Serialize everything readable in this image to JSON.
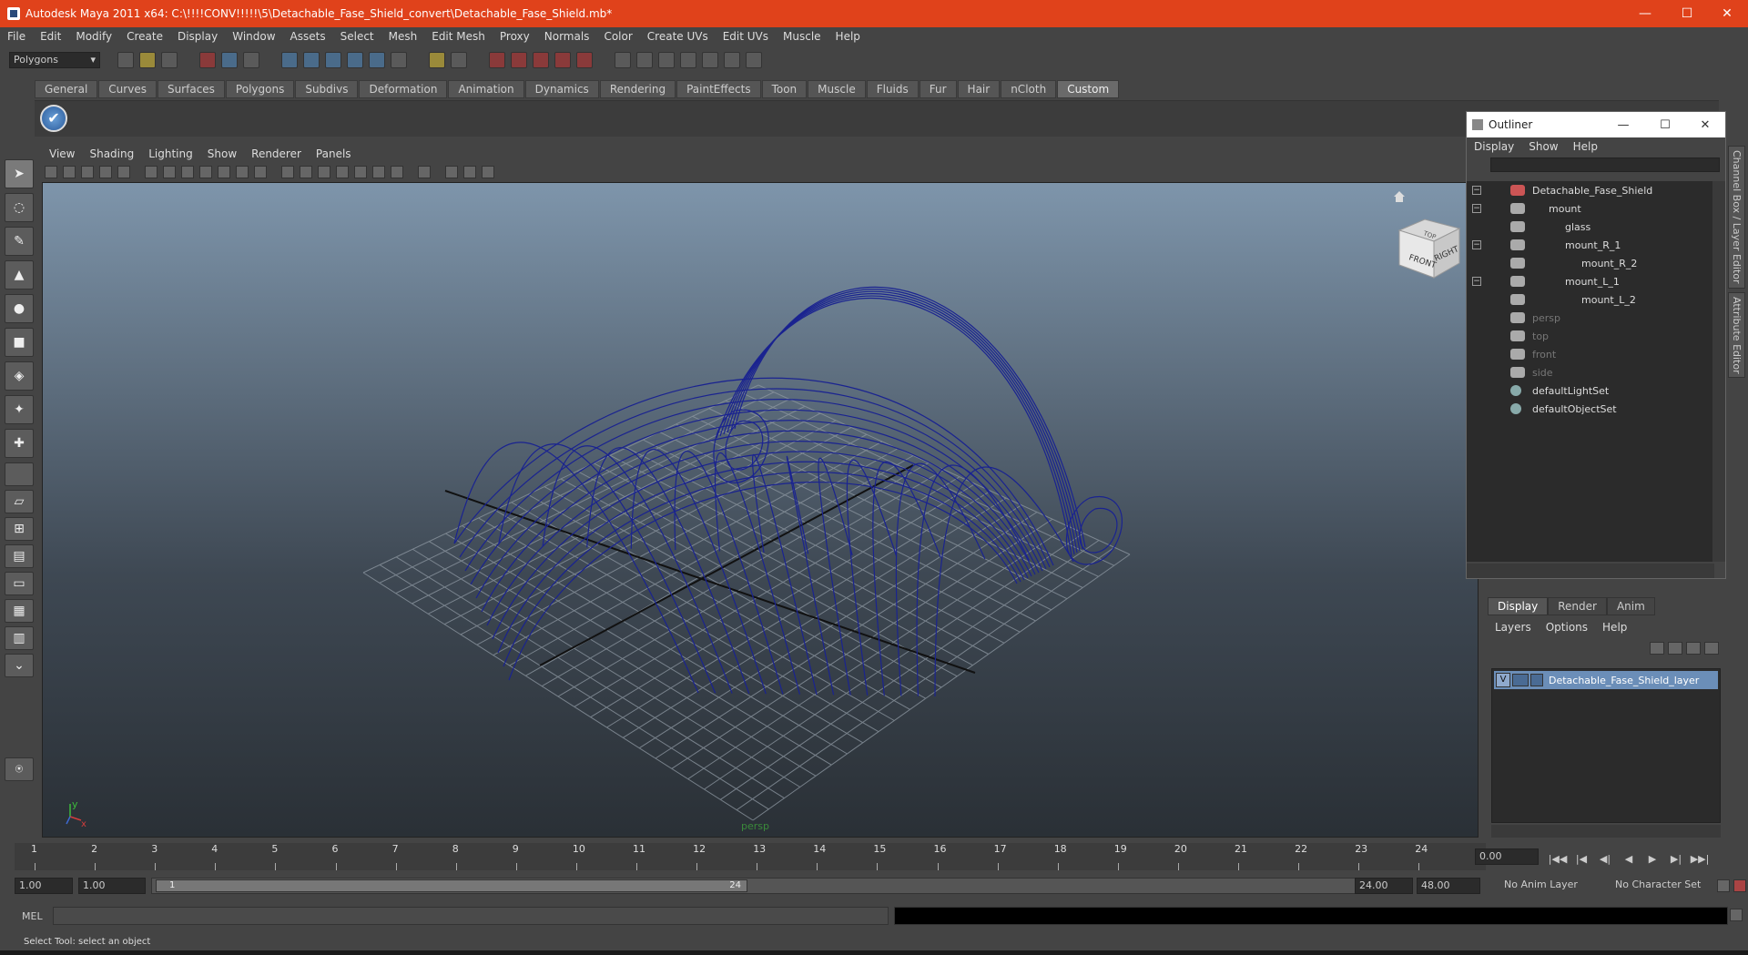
{
  "window": {
    "title": "Autodesk Maya 2011 x64: C:\\!!!!CONV!!!!!\\5\\Detachable_Fase_Shield_convert\\Detachable_Fase_Shield.mb*",
    "minimize": "—",
    "maximize": "☐",
    "close": "✕"
  },
  "menubar": [
    "File",
    "Edit",
    "Modify",
    "Create",
    "Display",
    "Window",
    "Assets",
    "Select",
    "Mesh",
    "Edit Mesh",
    "Proxy",
    "Normals",
    "Color",
    "Create UVs",
    "Edit UVs",
    "Muscle",
    "Help"
  ],
  "status_line": {
    "mode": "Polygons"
  },
  "shelf": {
    "tabs": [
      "General",
      "Curves",
      "Surfaces",
      "Polygons",
      "Subdivs",
      "Deformation",
      "Animation",
      "Dynamics",
      "Rendering",
      "PaintEffects",
      "Toon",
      "Muscle",
      "Fluids",
      "Fur",
      "Hair",
      "nCloth",
      "Custom"
    ],
    "active_tab": "Custom"
  },
  "viewport": {
    "menu": [
      "View",
      "Shading",
      "Lighting",
      "Show",
      "Renderer",
      "Panels"
    ],
    "camera_label": "persp",
    "viewcube": {
      "front": "FRONT",
      "right": "RIGHT",
      "top": "TOP"
    },
    "axis_y": "y",
    "axis_x": "x"
  },
  "outliner": {
    "title": "Outliner",
    "menu": [
      "Display",
      "Show",
      "Help"
    ],
    "items": [
      {
        "label": "Detachable_Fase_Shield",
        "depth": 0,
        "kind": "transform",
        "dim": false
      },
      {
        "label": "mount",
        "depth": 1,
        "kind": "transform",
        "dim": false
      },
      {
        "label": "glass",
        "depth": 2,
        "kind": "transform",
        "dim": false
      },
      {
        "label": "mount_R_1",
        "depth": 2,
        "kind": "transform",
        "dim": false
      },
      {
        "label": "mount_R_2",
        "depth": 3,
        "kind": "transform",
        "dim": false
      },
      {
        "label": "mount_L_1",
        "depth": 2,
        "kind": "transform",
        "dim": false
      },
      {
        "label": "mount_L_2",
        "depth": 3,
        "kind": "transform",
        "dim": false
      },
      {
        "label": "persp",
        "depth": 0,
        "kind": "camera",
        "dim": true
      },
      {
        "label": "top",
        "depth": 0,
        "kind": "camera",
        "dim": true
      },
      {
        "label": "front",
        "depth": 0,
        "kind": "camera",
        "dim": true
      },
      {
        "label": "side",
        "depth": 0,
        "kind": "camera",
        "dim": true
      },
      {
        "label": "defaultLightSet",
        "depth": 0,
        "kind": "set",
        "dim": false
      },
      {
        "label": "defaultObjectSet",
        "depth": 0,
        "kind": "set",
        "dim": false
      }
    ]
  },
  "layer_editor": {
    "tabs": [
      "Display",
      "Render",
      "Anim"
    ],
    "active_tab": "Display",
    "menu": [
      "Layers",
      "Options",
      "Help"
    ],
    "layers": [
      {
        "visible": "V",
        "name": "Detachable_Fase_Shield_layer"
      }
    ]
  },
  "side_tabs": [
    "Channel Box / Layer Editor",
    "Attribute Editor"
  ],
  "time_slider": {
    "ticks": [
      "1",
      "2",
      "3",
      "4",
      "5",
      "6",
      "7",
      "8",
      "9",
      "10",
      "11",
      "12",
      "13",
      "14",
      "15",
      "16",
      "17",
      "18",
      "19",
      "20",
      "21",
      "22",
      "23",
      "24"
    ],
    "current_time": "0.00"
  },
  "playback_controls": [
    "|◀◀",
    "|◀",
    "◀|",
    "◀",
    "▶",
    "▶|",
    "▶▶|"
  ],
  "range": {
    "start": "1.00",
    "playback_start": "1.00",
    "slider_start": "1",
    "slider_end": "24",
    "playback_end": "24.00",
    "end": "48.00",
    "anim_layer": "No Anim Layer",
    "character_set": "No Character Set"
  },
  "command_line": {
    "label": "MEL"
  },
  "help_line": "Select Tool: select an object"
}
